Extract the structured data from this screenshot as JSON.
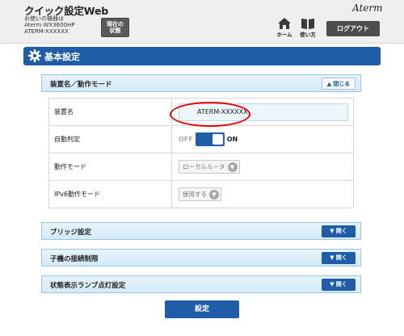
{
  "header": {
    "app_title": "クイック設定Web",
    "device_info_line1": "お使いの機器は",
    "device_info_line2": "Aterm WX3600HP",
    "device_info_line3": "ATERM-XXXXXX",
    "status_button_line1": "現在の",
    "status_button_line2": "状態",
    "brand": "Aterm",
    "home_label": "ホーム",
    "howto_label": "使い方",
    "logout_label": "ログアウト"
  },
  "page": {
    "title": "基本設定"
  },
  "sections": {
    "device_mode": {
      "title": "装置名／動作モード",
      "toggle_label": "閉じる"
    },
    "bridge": {
      "title": "ブリッジ設定",
      "toggle_label": "開く"
    },
    "child_limit": {
      "title": "子機の接続制限",
      "toggle_label": "開く"
    },
    "lamp": {
      "title": "状態表示ランプ点灯設定",
      "toggle_label": "開く"
    }
  },
  "settings": {
    "device_name": {
      "label": "装置名",
      "value": "ATERM-XXXXXX"
    },
    "auto_detect": {
      "label": "自動判定",
      "off_label": "OFF",
      "on_label": "ON",
      "state": "ON"
    },
    "mode": {
      "label": "動作モード",
      "value": "ローカルルータ"
    },
    "ipv6": {
      "label": "IPv6動作モード",
      "value": "使用する"
    }
  },
  "submit_label": "設定",
  "colors": {
    "accent": "#1f5da8",
    "section_bg": "#d3eaf9",
    "highlight": "#e00000"
  }
}
